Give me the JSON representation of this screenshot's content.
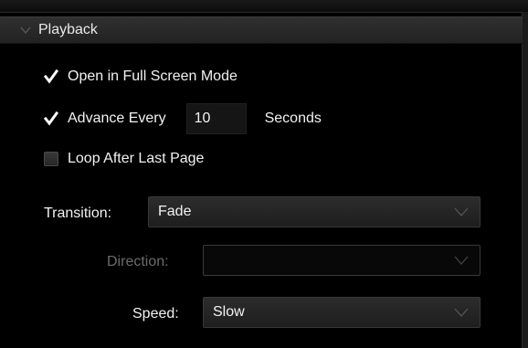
{
  "section": {
    "title": "Playback"
  },
  "options": {
    "full_screen": {
      "label": "Open in Full Screen Mode",
      "checked": true
    },
    "advance": {
      "label": "Advance Every",
      "value": "10",
      "unit": "Seconds",
      "checked": true
    },
    "loop": {
      "label": "Loop After Last Page",
      "checked": false
    }
  },
  "transition": {
    "label": "Transition:",
    "value": "Fade"
  },
  "direction": {
    "label": "Direction:",
    "value": "",
    "enabled": false
  },
  "speed": {
    "label": "Speed:",
    "value": "Slow"
  },
  "colors": {
    "background": "#000000",
    "header": "#2a2a2a",
    "text": "#f2f2f2",
    "disabled_text": "#6c6c6c"
  }
}
